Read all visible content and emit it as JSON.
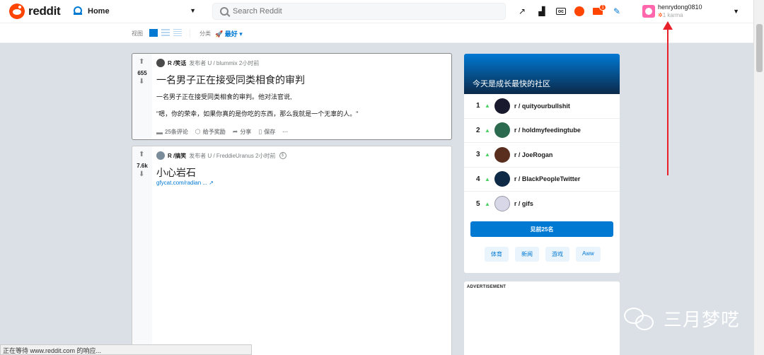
{
  "header": {
    "logo_text": "reddit",
    "feed_label": "Home",
    "search_placeholder": "Search Reddit",
    "user_name": "henrydong0810",
    "karma": "1 karma",
    "notif_badge_chat": "",
    "notif_badge_mail": "1",
    "coin_label": "oc"
  },
  "toolbar": {
    "view_label": "视图",
    "sort_label": "分类",
    "sort_value": "最好"
  },
  "posts": [
    {
      "score": "655",
      "subreddit": "R /笑话",
      "meta": "发布者 U / blummix 2小时前",
      "title": "一名男子正在接受同类相食的审判",
      "body1": "一名男子正在接受同类相食的审判。他对法官说,",
      "body2": "\"嗯，你的荣幸，如果你真的是你吃的东西，那么我就是一个无辜的人。\"",
      "comments": "25条评论",
      "award": "给予奖励",
      "share": "分享",
      "save": "保存",
      "more": "···"
    },
    {
      "score": "7.6k",
      "subreddit": "R /搞笑",
      "meta": "发布者 U / FreddieUranus 2小时前",
      "title": "小心岩石",
      "link": "gfycat.com/radian ..."
    }
  ],
  "sidebar": {
    "title": "今天是成长最快的社区",
    "communities": [
      {
        "rank": "1",
        "name": "r / quityourbullshit",
        "color": "#1a1a2e"
      },
      {
        "rank": "2",
        "name": "r / holdmyfeedingtube",
        "color": "#2b6a4e"
      },
      {
        "rank": "3",
        "name": "r / JoeRogan",
        "color": "#5a2e1e"
      },
      {
        "rank": "4",
        "name": "r / BlackPeopleTwitter",
        "color": "#0e2a47"
      },
      {
        "rank": "5",
        "name": "r / gifs",
        "color": "#d7d7e8"
      }
    ],
    "view_all": "见前25名",
    "tags": [
      "体育",
      "新闻",
      "游戏",
      "Aww"
    ]
  },
  "ad": {
    "label": "ADVERTISEMENT"
  },
  "watermark": {
    "text": "三月梦呓"
  },
  "status_bar": "正在等待 www.reddit.com 的响应..."
}
